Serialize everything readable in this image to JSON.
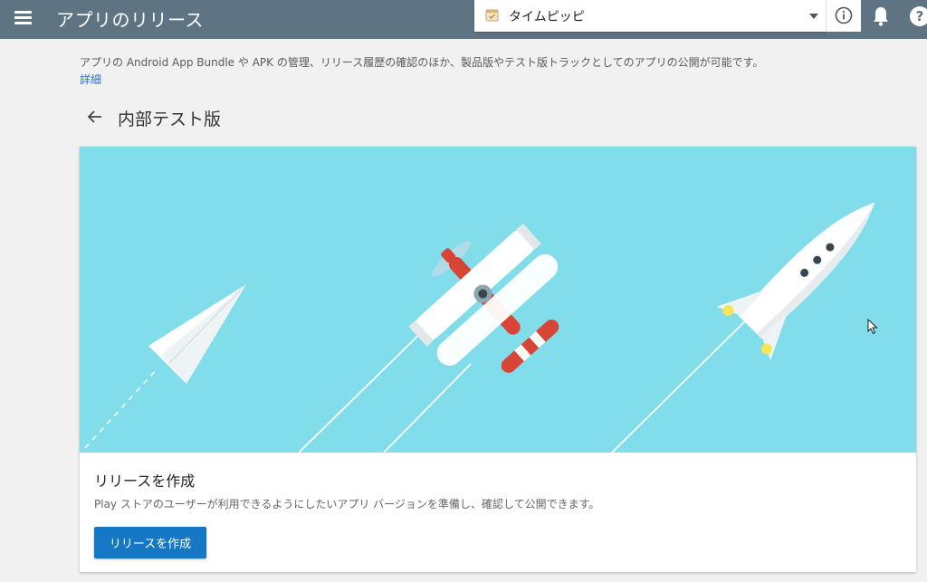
{
  "header": {
    "title": "アプリのリリース",
    "app_selector": {
      "selected": "タイムピッピ"
    },
    "icons": [
      "menu-icon",
      "calendar-icon",
      "info-icon",
      "notification-bell-icon",
      "help-icon"
    ]
  },
  "intro": {
    "description": "アプリの Android App Bundle や APK の管理、リリース履歴の確認のほか、製品版やテスト版トラックとしてのアプリの公開が可能です。",
    "details_link": "詳細"
  },
  "page": {
    "title": "内部テスト版"
  },
  "card": {
    "title": "リリースを作成",
    "description": "Play ストアのユーザーが利用できるようにしたいアプリ バージョンを準備し、確認して公開できます。",
    "button_label": "リリースを作成"
  },
  "colors": {
    "header_bg": "#5f7482",
    "hero_bg": "#80dde9",
    "primary_button": "#1677c5",
    "link": "#2a6fc9"
  }
}
